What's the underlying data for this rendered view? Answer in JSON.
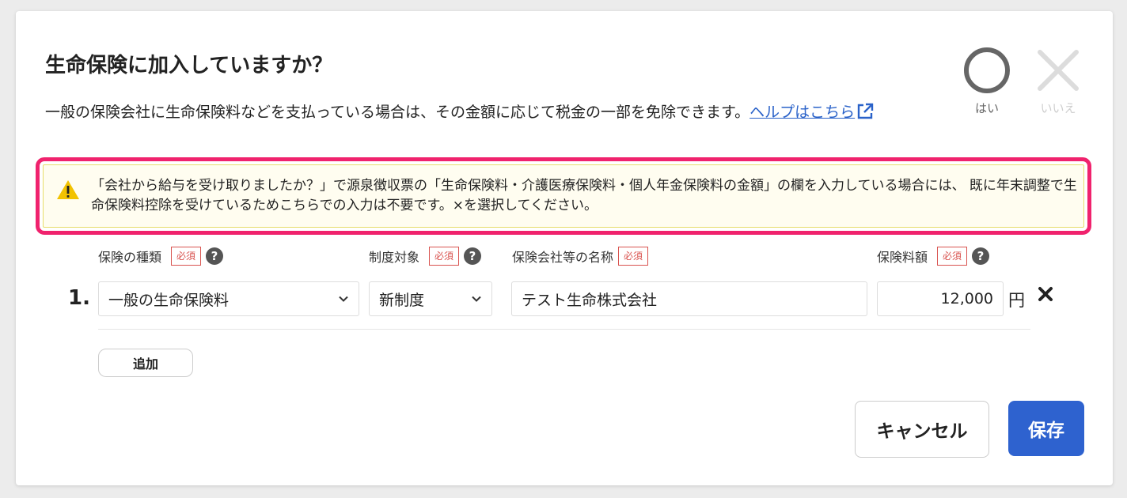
{
  "dialog": {
    "title": "生命保険に加入していますか？",
    "description": "一般の保険会社に生命保険料などを支払っている場合は、その金額に応じて税金の一部を免除できます。",
    "help_link": "ヘルプはこちら"
  },
  "choice": {
    "yes_label": "はい",
    "no_label": "いいえ",
    "selected": "はい"
  },
  "warning": {
    "text": "「会社から給与を受け取りましたか？」で源泉徴収票の「生命保険料・介護医療保険料・個人年金保険料の金額」の欄を入力している場合には、 既に年末調整で生命保険料控除を受けているためこちらでの入力は不要です。×を選択してください。"
  },
  "columns": {
    "type": "保険の種類",
    "system": "制度対象",
    "company": "保険会社等の名称",
    "amount": "保険料額",
    "required": "必須"
  },
  "rows": [
    {
      "number": "1.",
      "type": "一般の生命保険料",
      "system": "新制度",
      "company": "テスト生命株式会社",
      "amount": "12,000",
      "unit": "円"
    }
  ],
  "buttons": {
    "add": "追加",
    "cancel": "キャンセル",
    "save": "保存"
  },
  "colors": {
    "accent": "#2e62cf",
    "highlight": "#f0226d",
    "required": "#d9534f",
    "warning_icon": "#f2c200"
  }
}
